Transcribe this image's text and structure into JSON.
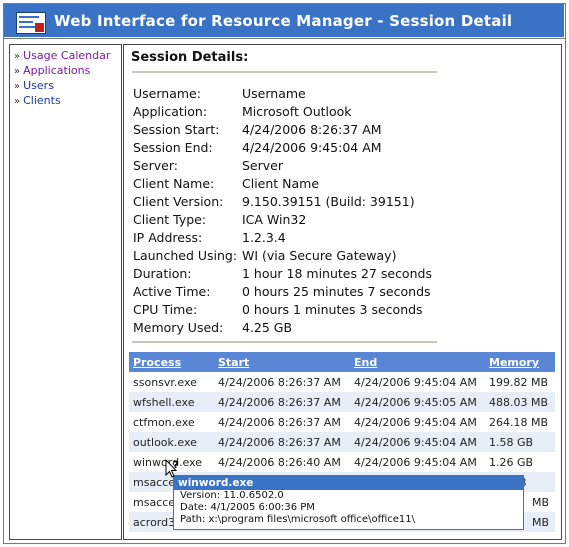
{
  "window": {
    "title": "Web Interface for Resource Manager - Session Detail"
  },
  "sidebar": {
    "items": [
      {
        "label": "Usage Calendar",
        "color": "#7a1a9a"
      },
      {
        "label": "Applications",
        "color": "#7a1a9a"
      },
      {
        "label": "Users",
        "color": "#1a3a9a"
      },
      {
        "label": "Clients",
        "color": "#1a3a9a"
      }
    ]
  },
  "main": {
    "heading": "Session Details:",
    "details": [
      {
        "key": "Username:",
        "value": "Username"
      },
      {
        "key": "Application:",
        "value": "Microsoft Outlook"
      },
      {
        "key": "Session Start:",
        "value": "4/24/2006 8:26:37 AM"
      },
      {
        "key": "Session End:",
        "value": "4/24/2006 9:45:04 AM"
      },
      {
        "key": "Server:",
        "value": "Server"
      },
      {
        "key": "Client Name:",
        "value": "Client Name"
      },
      {
        "key": "Client Version:",
        "value": "9.150.39151 (Build: 39151)"
      },
      {
        "key": "Client Type:",
        "value": "ICA Win32"
      },
      {
        "key": "IP Address:",
        "value": "1.2.3.4"
      },
      {
        "key": "Launched Using:",
        "value": "WI   (via Secure Gateway)"
      },
      {
        "key": "Duration:",
        "value": "1 hour 18 minutes 27 seconds"
      },
      {
        "key": "Active Time:",
        "value": "0 hours 25 minutes 7 seconds"
      },
      {
        "key": "CPU Time:",
        "value": "0 hours 1 minutes 3 seconds"
      },
      {
        "key": "Memory Used:",
        "value": "4.25 GB"
      }
    ],
    "table": {
      "columns": [
        "Process",
        "Start",
        "End",
        "Memory"
      ],
      "rows": [
        [
          "ssonsvr.exe",
          "4/24/2006 8:26:37 AM",
          "4/24/2006 9:45:04 AM",
          "199.82 MB"
        ],
        [
          "wfshell.exe",
          "4/24/2006 8:26:37 AM",
          "4/24/2006 9:45:05 AM",
          "488.03 MB"
        ],
        [
          "ctfmon.exe",
          "4/24/2006 8:26:37 AM",
          "4/24/2006 9:45:04 AM",
          "264.18 MB"
        ],
        [
          "outlook.exe",
          "4/24/2006 8:26:37 AM",
          "4/24/2006 9:45:04 AM",
          "1.58 GB"
        ],
        [
          "winword.exe",
          "4/24/2006 8:26:40 AM",
          "4/24/2006 9:45:04 AM",
          "1.26 GB"
        ],
        [
          "msacce",
          "",
          "",
          "B"
        ],
        [
          "msacce",
          "",
          "",
          "MB"
        ],
        [
          "acrord3",
          "",
          "",
          "MB"
        ]
      ]
    }
  },
  "tooltip": {
    "title": "winword.exe",
    "version": "Version: 11.0.6502.0",
    "date": "Date: 4/1/2005 6:00:36 PM",
    "path": "Path: x:\\program files\\microsoft office\\office11\\"
  },
  "colors": {
    "titlebar": "#3a72c6",
    "table_header": "#5a86d6",
    "row_alt": "#e8eef8"
  }
}
